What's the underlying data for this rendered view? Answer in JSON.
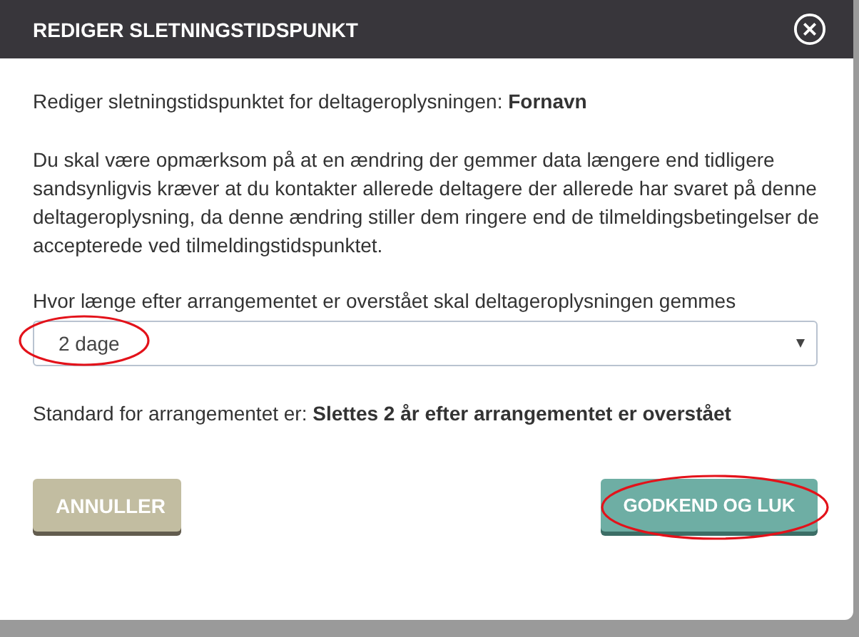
{
  "dialog": {
    "title": "REDIGER SLETNINGSTIDSPUNKT"
  },
  "intro": "Rediger sletningstidspunktet for deltageroplysningen: **Fornavn**",
  "warning": "Du skal være opmærksom på at en ændring der gemmer data længere end tidligere sandsynligvis kræver at du kontakter allerede deltagere der allerede har svaret på denne deltageroplysning, da denne ændring stiller dem ringere end de tilmeldingsbetingelser de accepterede ved tilmeldingstidspunktet.",
  "retention": {
    "label": "Hvor længe efter arrangementet er overstået skal deltageroplysningen gemmes",
    "value": "2 dage",
    "circled": true
  },
  "standard": "Standard for arrangementet er: **Slettes 2 år efter arrangementet er overstået**",
  "buttons": [
    {
      "label": "ANNULLER",
      "kind": "cancel",
      "circled": false
    },
    {
      "label": "GODKEND OG LUK",
      "kind": "confirm",
      "circled": true
    }
  ]
}
